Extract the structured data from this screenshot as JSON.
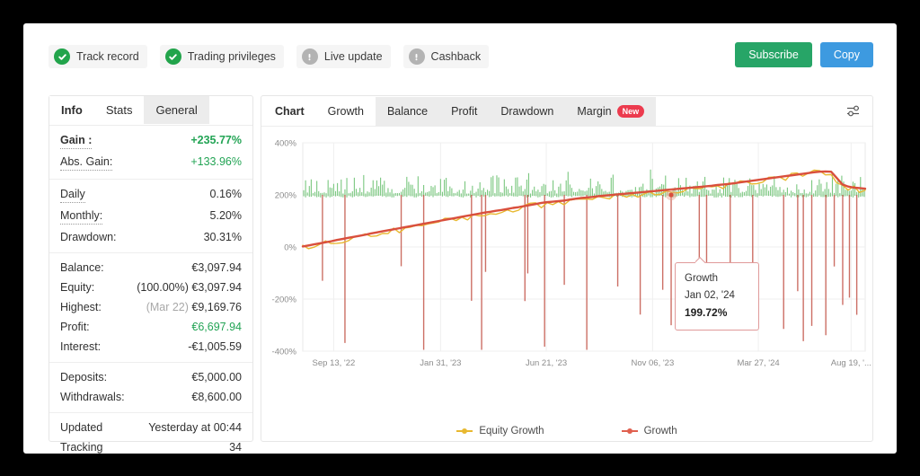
{
  "topbar": {
    "badges": [
      {
        "label": "Track record",
        "icon": "check-circle-icon",
        "state": "ok"
      },
      {
        "label": "Trading privileges",
        "icon": "check-circle-icon",
        "state": "ok"
      },
      {
        "label": "Live update",
        "icon": "exclamation-circle-icon",
        "state": "warn"
      },
      {
        "label": "Cashback",
        "icon": "exclamation-circle-icon",
        "state": "warn"
      }
    ],
    "subscribe_label": "Subscribe",
    "copy_label": "Copy",
    "subscribe_color": "#27a567",
    "copy_color": "#3d9ae0"
  },
  "stats": {
    "tabs": [
      {
        "label": "Info",
        "active": true
      },
      {
        "label": "Stats",
        "active": true
      },
      {
        "label": "General",
        "active": false
      }
    ],
    "groups": [
      {
        "rows": [
          {
            "key": "Gain :",
            "value": "+235.77%",
            "key_dotted": true,
            "key_bold": true,
            "value_class": "green-bold"
          },
          {
            "key": "Abs. Gain:",
            "value": "+133.96%",
            "key_dotted": true,
            "key_bold": false,
            "value_class": "green"
          }
        ]
      },
      {
        "rows": [
          {
            "key": "Daily",
            "value": "0.16%",
            "key_dotted": true,
            "key_bold": false,
            "value_class": "plain"
          },
          {
            "key": "Monthly:",
            "value": "5.20%",
            "key_dotted": true,
            "key_bold": false,
            "value_class": "plain"
          },
          {
            "key": "Drawdown:",
            "value": "30.31%",
            "key_dotted": false,
            "key_bold": false,
            "value_class": "plain"
          }
        ]
      },
      {
        "rows": [
          {
            "key": "Balance:",
            "value": "€3,097.94",
            "key_dotted": false,
            "key_bold": false,
            "value_class": "plain"
          },
          {
            "key": "Equity:",
            "prefix": "(100.00%)",
            "value": "€3,097.94",
            "key_dotted": false,
            "key_bold": false,
            "value_class": "plain"
          },
          {
            "key": "Highest:",
            "prefix": "(Mar 22)",
            "prefix_muted": true,
            "value": "€9,169.76",
            "key_dotted": false,
            "key_bold": false,
            "value_class": "plain"
          },
          {
            "key": "Profit:",
            "value": "€6,697.94",
            "key_dotted": false,
            "key_bold": false,
            "value_class": "green"
          },
          {
            "key": "Interest:",
            "value": "-€1,005.59",
            "key_dotted": false,
            "key_bold": false,
            "value_class": "plain"
          }
        ]
      },
      {
        "rows": [
          {
            "key": "Deposits:",
            "value": "€5,000.00",
            "key_dotted": false,
            "key_bold": false,
            "value_class": "plain"
          },
          {
            "key": "Withdrawals:",
            "value": "€8,600.00",
            "key_dotted": false,
            "key_bold": false,
            "value_class": "plain"
          }
        ]
      },
      {
        "rows": [
          {
            "key": "Updated",
            "value": "Yesterday at 00:44",
            "key_dotted": false,
            "key_bold": false,
            "value_class": "plain"
          },
          {
            "key": "Tracking",
            "value": "34",
            "key_dotted": false,
            "key_bold": false,
            "value_class": "plain"
          }
        ]
      }
    ]
  },
  "chart_panel": {
    "tabs": [
      {
        "label": "Chart",
        "active": true,
        "bold": true,
        "badge": null
      },
      {
        "label": "Growth",
        "active": true,
        "bold": false,
        "badge": null
      },
      {
        "label": "Balance",
        "active": false,
        "bold": false,
        "badge": null
      },
      {
        "label": "Profit",
        "active": false,
        "bold": false,
        "badge": null
      },
      {
        "label": "Drawdown",
        "active": false,
        "bold": false,
        "badge": null
      },
      {
        "label": "Margin",
        "active": false,
        "bold": false,
        "badge": "New"
      }
    ],
    "settings_icon": "sliders-icon",
    "tooltip": {
      "series": "Growth",
      "date": "Jan 02, '24",
      "value": "199.72%"
    }
  },
  "chart_data": {
    "type": "line",
    "title": "",
    "xlabel": "",
    "ylabel": "",
    "ylim": [
      -400,
      400
    ],
    "yticks": [
      400,
      200,
      0,
      -200,
      -400
    ],
    "ytick_labels": [
      "400%",
      "200%",
      "0%",
      "-200%",
      "-400%"
    ],
    "grid": true,
    "legend_position": "bottom",
    "xtick_labels": [
      "Sep 13, '22",
      "Jan 31, '23",
      "Jun 21, '23",
      "Nov 06, '23",
      "Mar 27, '24",
      "Aug 19, '..."
    ],
    "xtick_positions": [
      0.055,
      0.245,
      0.433,
      0.622,
      0.81,
      0.975
    ],
    "series": [
      {
        "name": "Growth",
        "color": "#d94f3d",
        "kind": "line",
        "values": [
          2,
          6,
          10,
          14,
          18,
          22,
          27,
          31,
          35,
          39,
          43,
          47,
          52,
          56,
          60,
          64,
          68,
          72,
          76,
          80,
          84,
          88,
          92,
          96,
          100,
          104,
          108,
          112,
          116,
          120,
          124,
          128,
          132,
          135,
          139,
          142,
          146,
          150,
          153,
          157,
          161,
          165,
          169,
          172,
          174,
          176,
          178,
          182,
          185,
          188,
          190,
          192,
          195,
          197,
          199,
          201,
          203,
          205,
          207,
          209,
          211,
          213,
          215,
          217,
          219,
          221,
          223,
          225,
          227,
          229,
          231,
          233,
          235,
          238,
          240,
          242,
          245,
          248,
          251,
          254,
          257,
          260,
          263,
          266,
          269,
          272,
          275,
          278,
          281,
          284,
          287,
          289,
          290,
          289,
          265,
          240,
          232,
          228,
          226,
          224
        ]
      },
      {
        "name": "Equity Growth",
        "color": "#e8b830",
        "kind": "line",
        "values": [
          -4,
          0,
          5,
          9,
          13,
          18,
          22,
          26,
          30,
          34,
          38,
          42,
          47,
          50,
          55,
          59,
          62,
          67,
          71,
          74,
          79,
          83,
          87,
          91,
          95,
          98,
          103,
          107,
          111,
          114,
          119,
          122,
          126,
          130,
          133,
          137,
          140,
          145,
          148,
          151,
          156,
          159,
          163,
          166,
          169,
          171,
          173,
          177,
          180,
          183,
          185,
          187,
          190,
          192,
          194,
          196,
          198,
          200,
          202,
          204,
          206,
          208,
          210,
          212,
          214,
          216,
          218,
          220,
          222,
          224,
          226,
          228,
          230,
          233,
          235,
          237,
          240,
          243,
          246,
          249,
          252,
          255,
          258,
          261,
          264,
          266,
          270,
          272,
          276,
          278,
          282,
          284,
          286,
          282,
          258,
          234,
          227,
          223,
          221,
          220
        ]
      }
    ],
    "bars": {
      "name": "Activity",
      "color": "#7ac77f",
      "baseline": 200,
      "note": "dense green vertical spikes clustered between roughly 195% and 275%"
    },
    "drops": {
      "name": "Drawdown spikes",
      "color": "#c4564b",
      "note": "sparse vertical red lines descending from the green band toward negative values"
    },
    "highlight_point": {
      "x_label": "Jan 02, '24",
      "y": 199.72,
      "series": "Growth"
    }
  },
  "legend": [
    {
      "label": "Equity Growth",
      "color": "#e8b830"
    },
    {
      "label": "Growth",
      "color": "#e0604f"
    }
  ]
}
